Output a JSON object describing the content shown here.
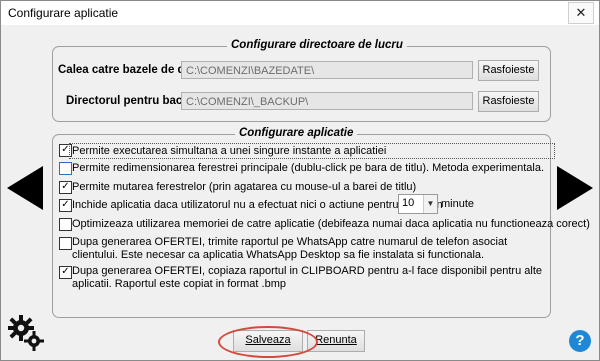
{
  "window": {
    "title": "Configurare aplicatie",
    "close_glyph": "✕"
  },
  "dirs": {
    "legend": "Configurare directoare de lucru",
    "db_label": "Calea catre bazele de date:",
    "db_value": "C:\\COMENZI\\BAZEDATE\\",
    "backup_label": "Directorul pentru backup:",
    "backup_value": "C:\\COMENZI\\_BACKUP\\",
    "browse_label": "Rasfoieste"
  },
  "app": {
    "legend": "Configurare aplicatie",
    "options": [
      {
        "text": "Permite executarea simultana a unei singure instante a aplicatiei",
        "checked": true
      },
      {
        "text": "Permite redimensionarea ferestrei principale (dublu-click pe bara de titlu). Metoda experimentala.",
        "checked": false
      },
      {
        "text": "Permite mutarea ferestrelor (prin agatarea cu mouse-ul a barei de titlu)",
        "checked": true
      },
      {
        "text": "Inchide aplicatia daca utilizatorul nu a efectuat nici o actiune pentru cel putin",
        "checked": true
      },
      {
        "text": "Optimizeaza utilizarea memoriei de catre aplicatie (debifeaza numai daca aplicatia nu functioneaza corect)",
        "checked": false
      },
      {
        "text": "Dupa generarea OFERTEI, trimite raportul pe WhatsApp catre numarul de telefon asociat clientului.  Este necesar ca aplicatia WhatsApp Desktop sa fie instalata si functionala.",
        "checked": false
      },
      {
        "text": "Dupa generarea OFERTEI, copiaza raportul in CLIPBOARD pentru a-l face disponibil pentru alte aplicatii. Raportul este copiat in format .bmp",
        "checked": true
      }
    ],
    "timeout_value": "10",
    "timeout_unit": "minute"
  },
  "footer": {
    "save_label": "Salveaza",
    "cancel_label": "Renunta",
    "help_glyph": "?"
  },
  "icons": {
    "left": "triangle-left-icon",
    "right": "triangle-right-icon",
    "settings": "settings-gears-icon",
    "help": "help-icon"
  }
}
